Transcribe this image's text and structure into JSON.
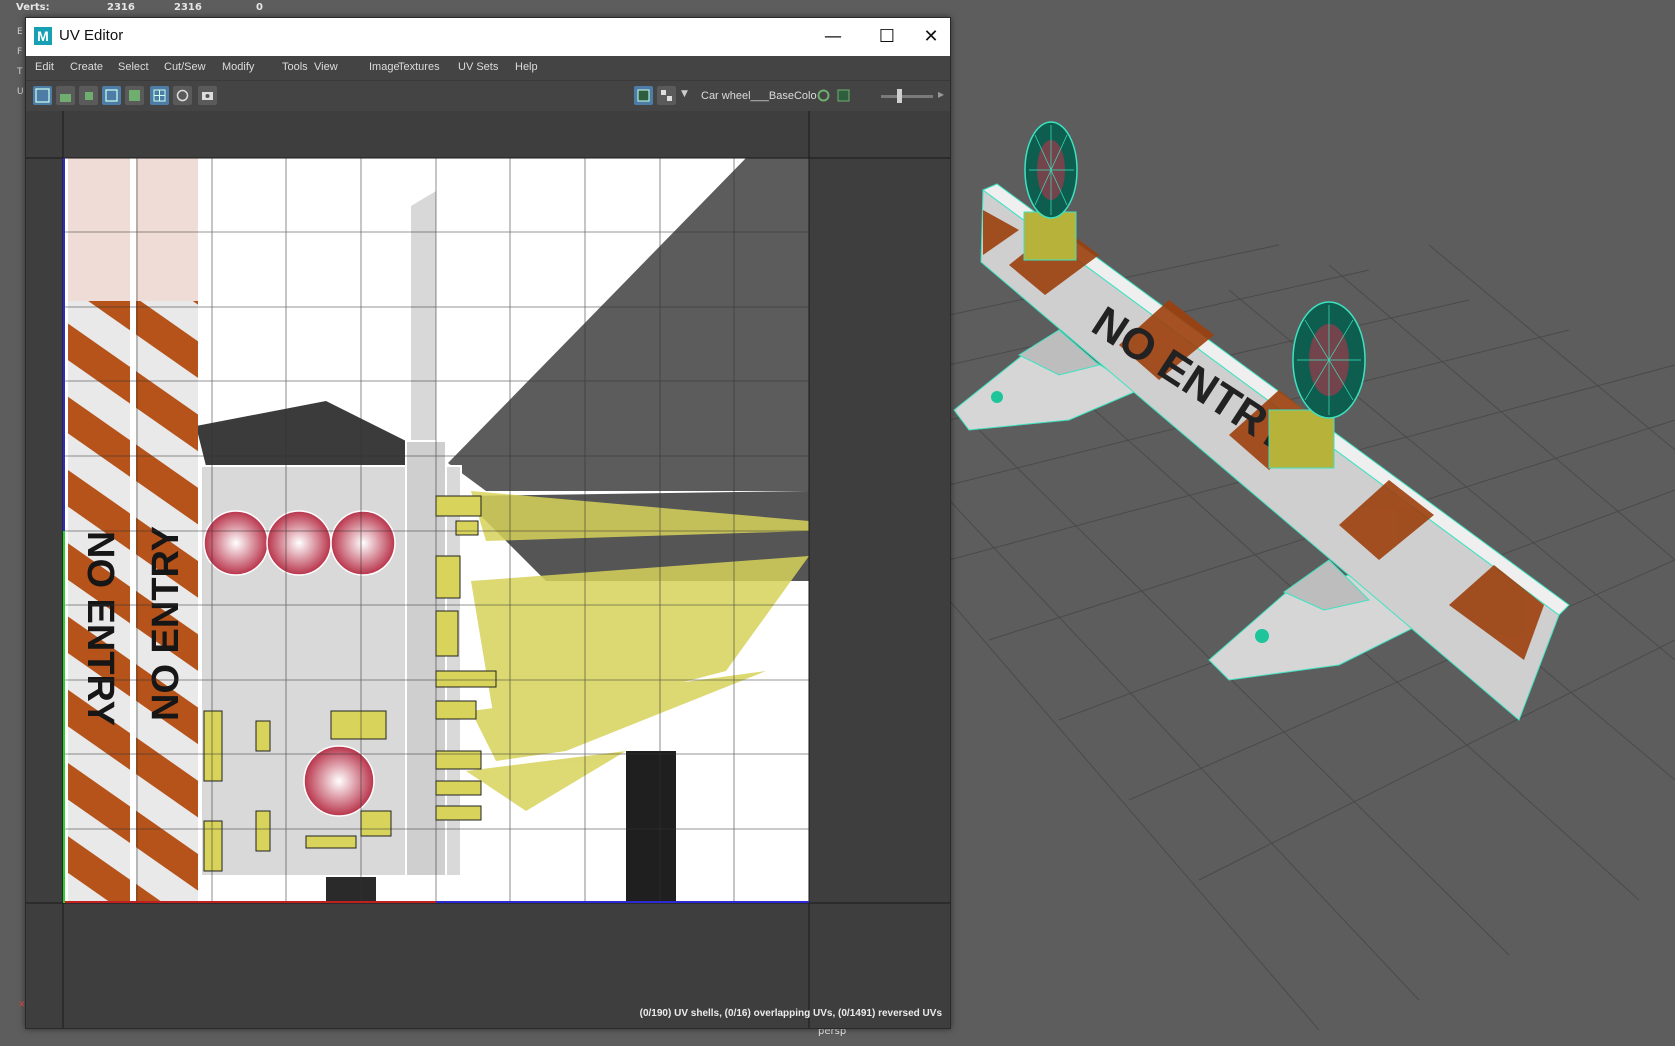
{
  "hud": {
    "verts_label": "Verts:",
    "verts_a": "2316",
    "verts_b": "2316",
    "verts_c": "0",
    "side_letters": [
      "E",
      "F",
      "T",
      "U"
    ]
  },
  "window": {
    "title": "UV Editor",
    "app_icon": "M",
    "minimize_icon": "—",
    "maximize_icon": "☐",
    "close_icon": "✕"
  },
  "menu": [
    "Edit",
    "Create",
    "Select",
    "Cut/Sew",
    "Modify",
    "Tools",
    "View",
    "Image",
    "Textures",
    "UV Sets",
    "Help"
  ],
  "toolbar": {
    "texture_name": "Car wheel___BaseColo",
    "exposure_level": 0.35
  },
  "status": {
    "uv_summary": "(0/190) UV shells, (0/16) overlapping UVs, (0/1491) reversed UVs"
  },
  "viewport": {
    "camera": "persp",
    "sign_text": "NO ENTRY"
  },
  "uv_texture": {
    "stripe_text": "NO ENTRY"
  },
  "colors": {
    "accent_blue": "#4d7da6",
    "hazard_orange": "#b5531a",
    "wire_cyan": "#3de3c0",
    "reflector_red": "#b8334a",
    "yellow_shell": "#d8d35a"
  }
}
